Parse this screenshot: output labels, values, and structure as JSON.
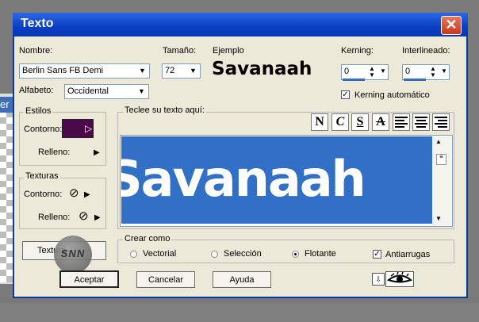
{
  "background_tab_text": "er",
  "dialog": {
    "title": "Texto",
    "close_glyph": "✕"
  },
  "font": {
    "label": "Nombre:",
    "value": "Berlin Sans FB Demi",
    "alphabet_label": "Alfabeto:",
    "alphabet_value": "Occidental"
  },
  "size": {
    "label": "Tamaño:",
    "value": "72"
  },
  "sample": {
    "label": "Ejemplo",
    "text": "Savanaah"
  },
  "kerning": {
    "label": "Kerning:",
    "value": "0",
    "auto_label": "Kerning automático",
    "auto_checked": "✓"
  },
  "leading": {
    "label": "Interlineado:",
    "value": "0"
  },
  "styles": {
    "legend": "Estilos",
    "outline_label": "Contorno:",
    "fill_label": "Relleno:",
    "outline_color": "#4a0a4a"
  },
  "textures": {
    "legend": "Texturas",
    "outline_label": "Contorno:",
    "fill_label": "Relleno:"
  },
  "text_entry": {
    "legend": "Teclee su texto aquí:",
    "content": "Savanaah",
    "bold": "N",
    "italic": "C",
    "underline": "S",
    "strike": "A"
  },
  "create_as": {
    "legend": "Crear como",
    "options": [
      "Vectorial",
      "Selección",
      "Flotante"
    ],
    "selected": "Flotante",
    "antialias_label": "Antiarrugas",
    "antialias_checked": "✓"
  },
  "buttons": {
    "texture": "Textura",
    "accept": "Aceptar",
    "cancel": "Cancelar",
    "help": "Ayuda"
  },
  "watermark": "SNN",
  "colors": {
    "selection": "#3170c6",
    "title_bar": "#0a3fc4"
  }
}
